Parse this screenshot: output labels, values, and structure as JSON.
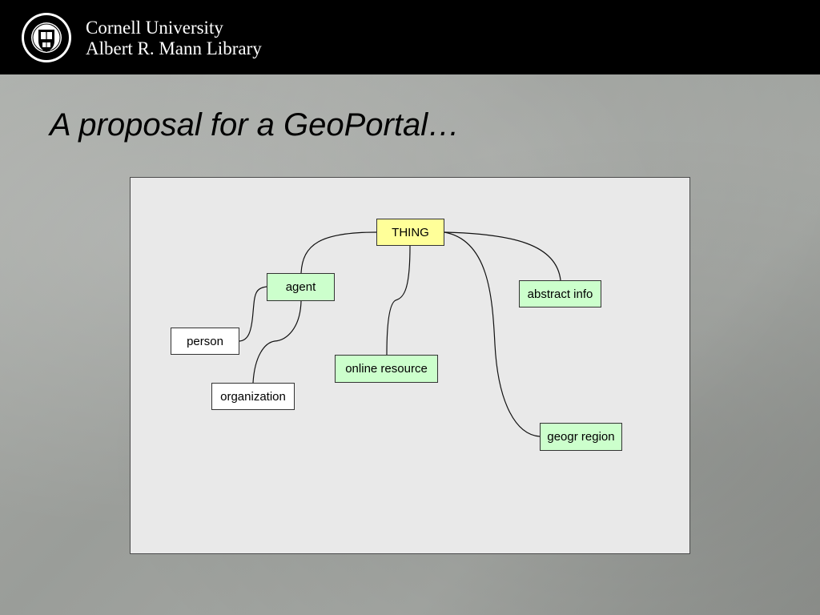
{
  "header": {
    "institution": "Cornell University",
    "library": "Albert R. Mann Library"
  },
  "slide": {
    "title": "A proposal for a GeoPortal…"
  },
  "diagram": {
    "nodes": {
      "thing": "THING",
      "agent": "agent",
      "person": "person",
      "organization": "organization",
      "online_resource": "online resource",
      "abstract_info": "abstract info",
      "geogr_region": "geogr region"
    },
    "colors": {
      "root": "#ffff99",
      "category": "#ccffcc",
      "leaf": "#ffffff"
    }
  },
  "colors": {
    "header_bg": "#000000",
    "slide_bg": "#9fa29e",
    "panel_bg": "#e9e9e9"
  }
}
